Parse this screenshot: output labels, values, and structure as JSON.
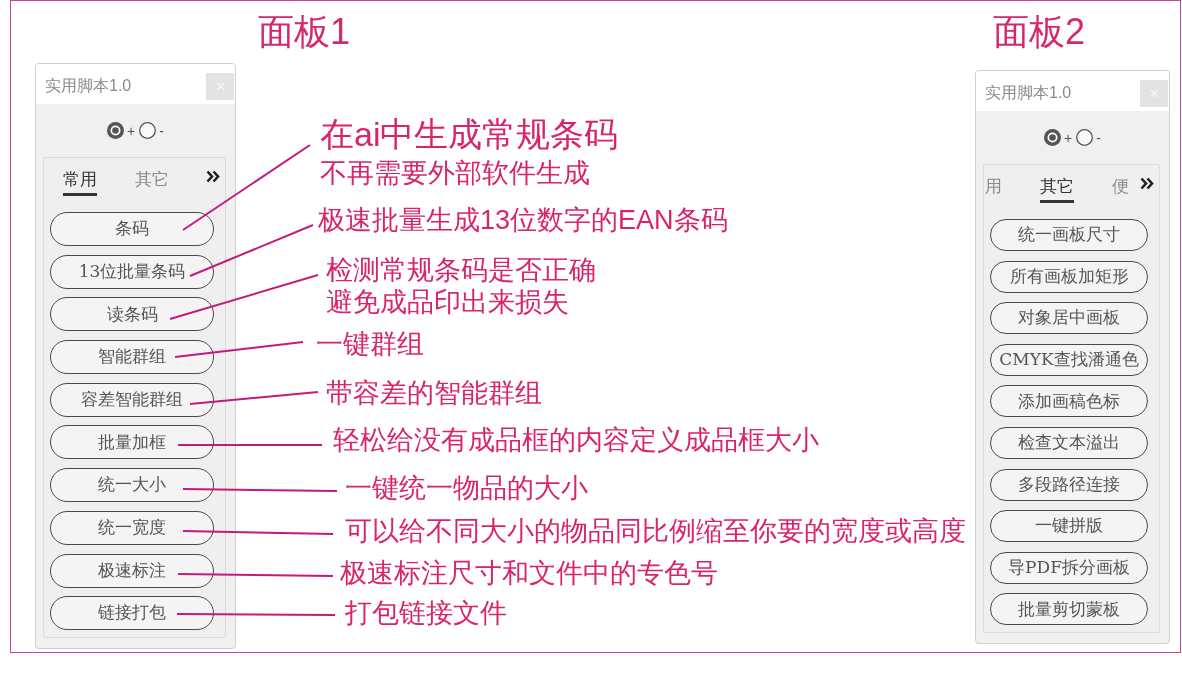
{
  "panels": [
    {
      "caption": "面板1",
      "window_title": "实用脚本1.0",
      "mode_options": [
        {
          "label": "+",
          "selected": true
        },
        {
          "label": "-",
          "selected": false
        }
      ],
      "tabs": [
        {
          "label": "常用",
          "selected": true
        },
        {
          "label": "其它",
          "selected": false
        }
      ],
      "buttons": [
        "条码",
        "13位批量条码",
        "读条码",
        "智能群组",
        "容差智能群组",
        "批量加框",
        "统一大小",
        "统一宽度",
        "极速标注",
        "链接打包"
      ]
    },
    {
      "caption": "面板2",
      "window_title": "实用脚本1.0",
      "mode_options": [
        {
          "label": "+",
          "selected": true
        },
        {
          "label": "-",
          "selected": false
        }
      ],
      "tabs": [
        {
          "label": "用",
          "selected": false
        },
        {
          "label": "其它",
          "selected": true
        },
        {
          "label": "便",
          "selected": false
        }
      ],
      "buttons": [
        "统一画板尺寸",
        "所有画板加矩形",
        "对象居中画板",
        "CMYK查找潘通色",
        "添加画稿色标",
        "检查文本溢出",
        "多段路径连接",
        "一键拼版",
        "导PDF拆分画板",
        "批量剪切蒙板"
      ]
    }
  ],
  "callouts": [
    {
      "lines": [
        {
          "text": "在ai中生成常规条码",
          "kind": "headline"
        },
        {
          "text": "不再需要外部软件生成",
          "kind": "note"
        }
      ]
    },
    {
      "lines": [
        {
          "text": "极速批量生成13位数字的EAN条码",
          "kind": "note"
        }
      ]
    },
    {
      "lines": [
        {
          "text": "检测常规条码是否正确",
          "kind": "note"
        },
        {
          "text": "避免成品印出来损失",
          "kind": "note"
        }
      ]
    },
    {
      "lines": [
        {
          "text": "一键群组",
          "kind": "note"
        }
      ]
    },
    {
      "lines": [
        {
          "text": "带容差的智能群组",
          "kind": "note"
        }
      ]
    },
    {
      "lines": [
        {
          "text": "轻松给没有成品框的内容定义成品框大小",
          "kind": "note"
        }
      ]
    },
    {
      "lines": [
        {
          "text": "一键统一物品的大小",
          "kind": "note"
        }
      ]
    },
    {
      "lines": [
        {
          "text": "可以给不同大小的物品同比例缩至你要的宽度或高度",
          "kind": "note"
        }
      ]
    },
    {
      "lines": [
        {
          "text": "极速标注尺寸和文件中的专色号",
          "kind": "note"
        }
      ]
    },
    {
      "lines": [
        {
          "text": "打包链接文件",
          "kind": "note"
        }
      ]
    }
  ]
}
